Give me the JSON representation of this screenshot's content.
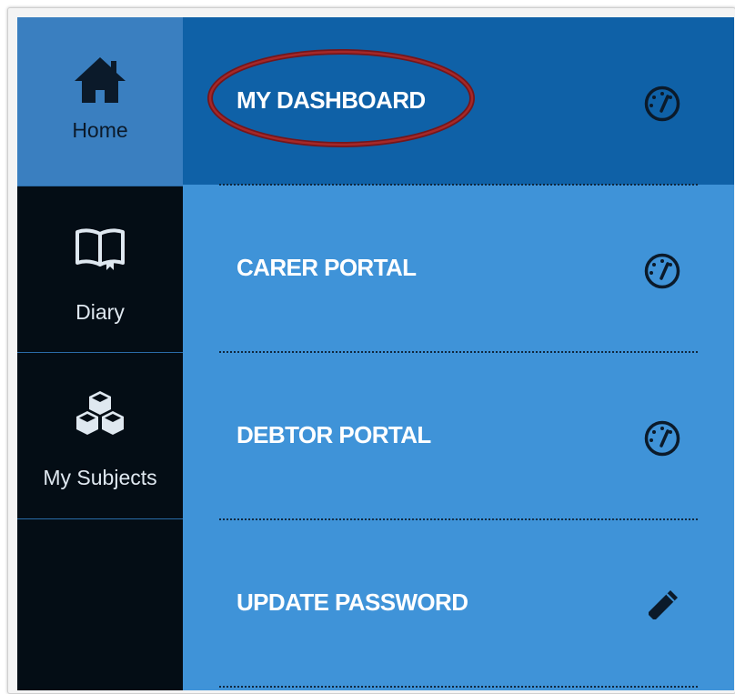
{
  "sidebar": {
    "items": [
      {
        "label": "Home",
        "icon": "house-icon",
        "active": true
      },
      {
        "label": "Diary",
        "icon": "open-book-icon"
      },
      {
        "label": "My Subjects",
        "icon": "cubes-icon"
      }
    ]
  },
  "menu": {
    "items": [
      {
        "label": "MY DASHBOARD",
        "icon": "speedometer-icon",
        "active": true
      },
      {
        "label": "CARER PORTAL",
        "icon": "speedometer-icon"
      },
      {
        "label": "DEBTOR PORTAL",
        "icon": "speedometer-icon"
      },
      {
        "label": "UPDATE PASSWORD",
        "icon": "pencil-icon"
      }
    ]
  },
  "annotation": {
    "shape": "ellipse",
    "color": "#8b1a1a",
    "target": "MY DASHBOARD"
  },
  "colors": {
    "active_sidebar": "#3a7fc0",
    "sidebar_dark": "#040d15",
    "menu_bg": "#3f93d8",
    "menu_active": "#0f61a7"
  }
}
